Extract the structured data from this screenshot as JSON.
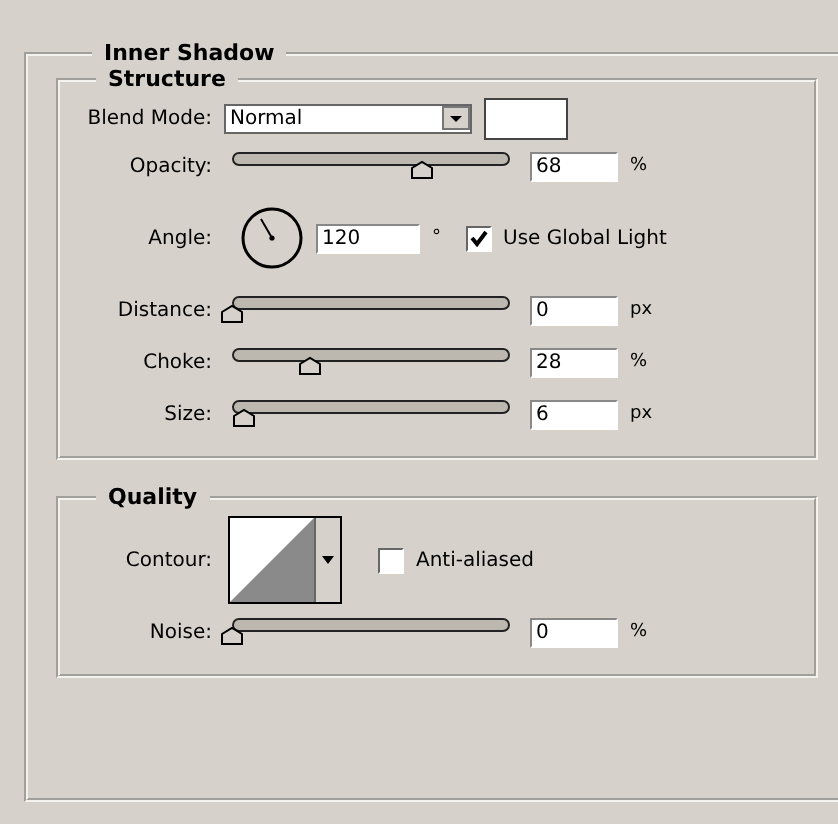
{
  "panel": {
    "title": "Inner Shadow"
  },
  "structure": {
    "title": "Structure",
    "rows": [
      {
        "kind": "dropdown",
        "label": "Blend Mode:",
        "value": "Normal"
      },
      {
        "kind": "slider",
        "label": "Opacity:",
        "level": 0.68,
        "value": "68",
        "unit": "%"
      },
      {
        "kind": "angle",
        "label": "Angle:",
        "value": "120",
        "unit": "°",
        "checkbox": {
          "label": "Use Global Light",
          "checked": true
        }
      },
      {
        "kind": "slider",
        "label": "Distance:",
        "level": 0,
        "value": "0",
        "unit": "px"
      },
      {
        "kind": "slider",
        "label": "Choke:",
        "level": 0.28,
        "value": "28",
        "unit": "%"
      },
      {
        "kind": "slider",
        "label": "Size:",
        "level": 0.04,
        "value": "6",
        "unit": "px"
      }
    ]
  },
  "quality": {
    "title": "Quality",
    "rows": [
      {
        "kind": "contour",
        "label": "Contour:",
        "checkbox": {
          "label": "Anti-aliased",
          "checked": false
        }
      },
      {
        "kind": "slider",
        "label": "Noise:",
        "level": 0,
        "value": "0",
        "unit": "%"
      }
    ]
  }
}
